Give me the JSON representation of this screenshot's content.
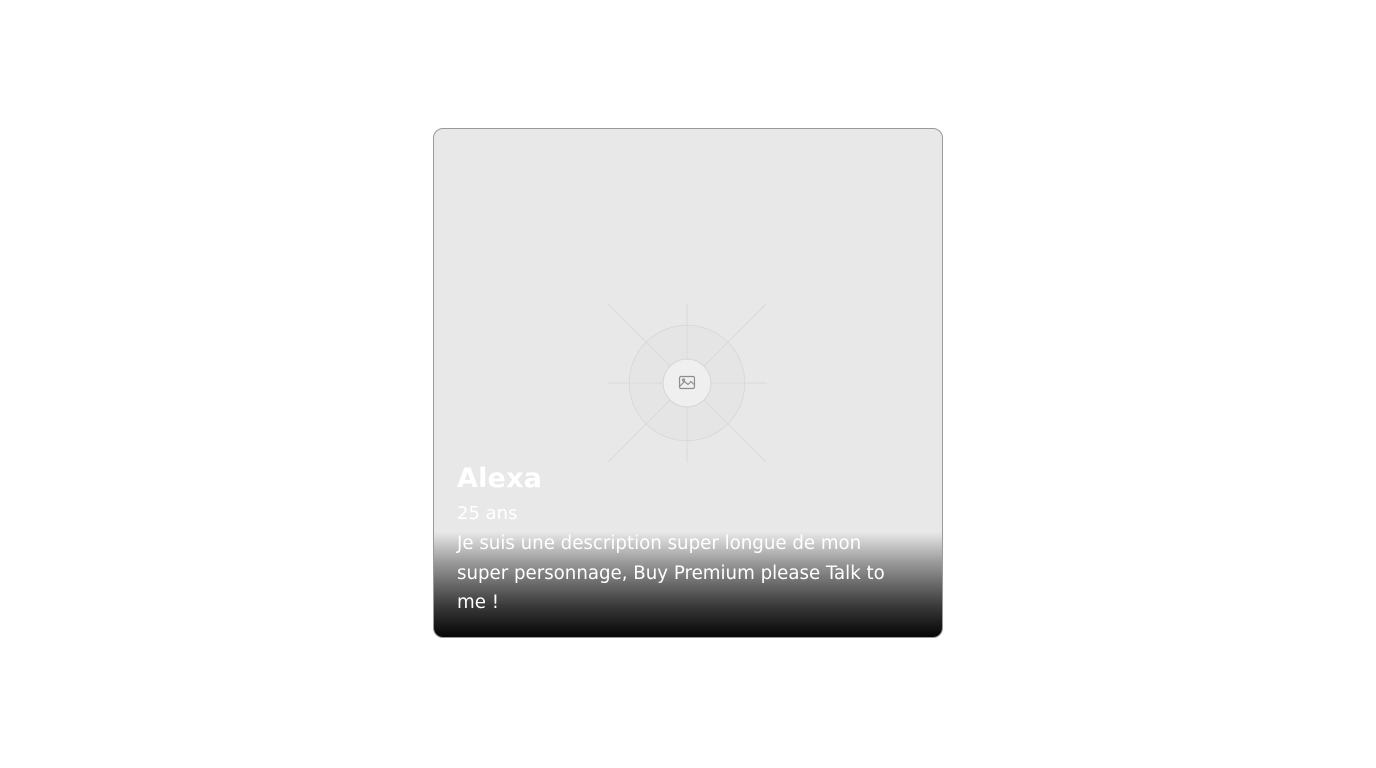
{
  "profile_card": {
    "image": {
      "icon": "image-icon",
      "background_color": "#e8e8e8"
    },
    "name": "Alexa",
    "age": "25 ans",
    "description": "Je suis une description super longue de mon super personnage, Buy Premium please Talk to me !",
    "text_color": "#ffffff"
  }
}
